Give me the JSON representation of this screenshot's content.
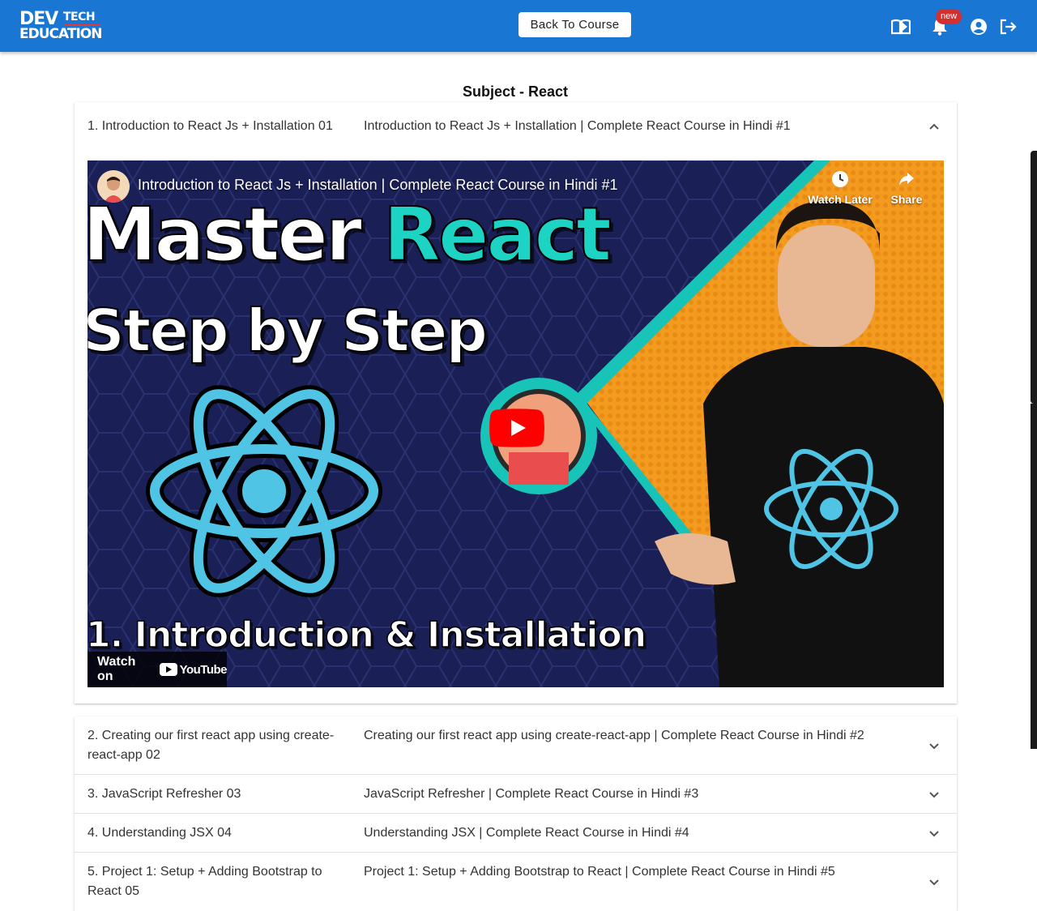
{
  "header": {
    "logo_line1": "DEV",
    "logo_line1b": "TECH",
    "logo_line2": "EDUCATION",
    "back_label": "Back To Course",
    "badge_label": "new",
    "icons": [
      "book-open-icon",
      "bell-icon",
      "user-circle-icon",
      "logout-icon"
    ],
    "bg_color": "#1976d2",
    "badge_color": "#d32f2f"
  },
  "subject_title": "Subject - React",
  "video": {
    "title": "Introduction to React Js + Installation | Complete React Course in Hindi #1",
    "watch_later": "Watch Later",
    "share": "Share",
    "thumb_line1_a": "Master ",
    "thumb_line1_b": "React",
    "thumb_line2": "Step by Step",
    "thumb_line3": "1. Introduction & Installation",
    "watch_on": "Watch on",
    "youtube": "YouTube",
    "accent_color": "#1dd3c4"
  },
  "lessons": [
    {
      "num": "1. Introduction to React Js + Installation 01",
      "title": "Introduction to React Js + Installation | Complete React Course in Hindi #1",
      "expanded": true
    },
    {
      "num": "2. Creating our first react app using create-react-app 02",
      "title": "Creating our first react app using create-react-app | Complete React Course in Hindi #2",
      "expanded": false
    },
    {
      "num": "3. JavaScript Refresher 03",
      "title": "JavaScript Refresher | Complete React Course in Hindi #3",
      "expanded": false
    },
    {
      "num": "4. Understanding JSX 04",
      "title": "Understanding JSX | Complete React Course in Hindi #4",
      "expanded": false
    },
    {
      "num": "5. Project 1: Setup + Adding Bootstrap to React 05",
      "title": "Project 1: Setup + Adding Bootstrap to React | Complete React Course in Hindi #5",
      "expanded": false
    }
  ]
}
